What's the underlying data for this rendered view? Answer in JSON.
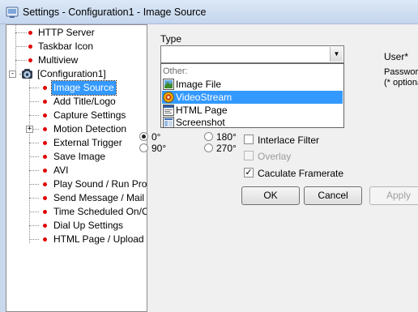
{
  "window": {
    "title": "Settings - Configuration1 - Image Source"
  },
  "tree": {
    "top_items": [
      {
        "label": "HTTP Server"
      },
      {
        "label": "Taskbar Icon"
      },
      {
        "label": "Multiview"
      }
    ],
    "config_node": {
      "label": "[Configuration1]",
      "expander": "-"
    },
    "children": [
      {
        "label": "Image Source",
        "selected": true
      },
      {
        "label": "Add Title/Logo"
      },
      {
        "label": "Capture Settings"
      },
      {
        "label": "Motion Detection",
        "expander": "+"
      },
      {
        "label": "External Trigger"
      },
      {
        "label": "Save Image"
      },
      {
        "label": "AVI"
      },
      {
        "label": "Play Sound / Run Progı"
      },
      {
        "label": "Send Message / Mail"
      },
      {
        "label": "Time Scheduled On/Of"
      },
      {
        "label": "Dial Up Settings"
      },
      {
        "label": "HTML Page / Upload"
      }
    ],
    "dot_color": "#e00000",
    "selection_color": "#3399ff"
  },
  "source": {
    "type_label": "Type",
    "combo_value": "",
    "combo_arrow": "▼",
    "dropdown": {
      "group_label": "Other:",
      "options": [
        {
          "label": "Image File",
          "icon": "image-file-icon"
        },
        {
          "label": "VideoStream",
          "icon": "videostream-icon",
          "selected": true
        },
        {
          "label": "HTML Page",
          "icon": "html-page-icon"
        },
        {
          "label": "Screenshot",
          "icon": "screenshot-icon"
        }
      ]
    },
    "rotation": [
      {
        "label": "0°",
        "checked": true
      },
      {
        "label": "180°",
        "checked": false
      },
      {
        "label": "90°",
        "checked": false
      },
      {
        "label": "270°",
        "checked": false
      }
    ],
    "interlace_filter": {
      "label": "Interlace Filter",
      "checked": false
    },
    "overlay": {
      "label": "Overlay",
      "checked": false,
      "disabled": true
    },
    "calculate_framerate": {
      "label": "Caculate Framerate",
      "checked": true
    },
    "user_label": "User*",
    "password_label": "Passwor",
    "optional_label": "(* optiona"
  },
  "buttons": {
    "ok": "OK",
    "cancel": "Cancel",
    "apply": "Apply"
  }
}
